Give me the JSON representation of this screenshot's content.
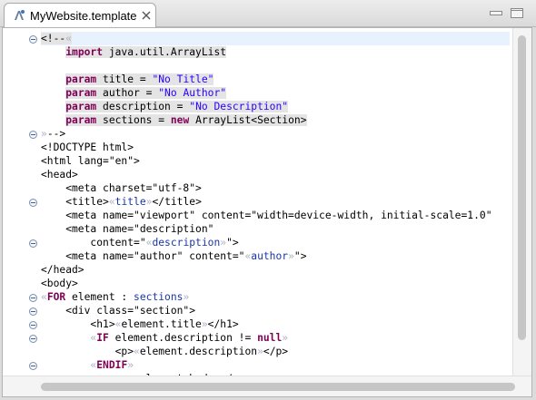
{
  "tab": {
    "title": "MyWebsite.template",
    "icon": "template-file-icon",
    "close_icon": "close-icon"
  },
  "window_controls": {
    "minimize_icon": "minimize-icon",
    "maximize_icon": "maximize-icon"
  },
  "editor": {
    "lines": [
      {
        "segs": [
          {
            "t": "<!--",
            "c": ""
          },
          {
            "t": "«",
            "c": "delim"
          }
        ],
        "cls": "current tpl"
      },
      {
        "segs": [
          {
            "t": "    ",
            "c": ""
          },
          {
            "t": "import",
            "c": "kw"
          },
          {
            "t": " java.util.ArrayList",
            "c": ""
          }
        ],
        "cls": "tpl"
      },
      {
        "segs": [
          {
            "t": " ",
            "c": ""
          }
        ],
        "cls": ""
      },
      {
        "segs": [
          {
            "t": "    ",
            "c": ""
          },
          {
            "t": "param",
            "c": "kw"
          },
          {
            "t": " title = ",
            "c": ""
          },
          {
            "t": "\"No Title\"",
            "c": "str"
          }
        ],
        "cls": "tpl"
      },
      {
        "segs": [
          {
            "t": "    ",
            "c": ""
          },
          {
            "t": "param",
            "c": "kw"
          },
          {
            "t": " author = ",
            "c": ""
          },
          {
            "t": "\"No Author\"",
            "c": "str"
          }
        ],
        "cls": "tpl"
      },
      {
        "segs": [
          {
            "t": "    ",
            "c": ""
          },
          {
            "t": "param",
            "c": "kw"
          },
          {
            "t": " description = ",
            "c": ""
          },
          {
            "t": "\"No Description\"",
            "c": "str"
          }
        ],
        "cls": "tpl"
      },
      {
        "segs": [
          {
            "t": "    ",
            "c": ""
          },
          {
            "t": "param",
            "c": "kw"
          },
          {
            "t": " sections = ",
            "c": ""
          },
          {
            "t": "new",
            "c": "kw"
          },
          {
            "t": " ArrayList<Section>",
            "c": ""
          }
        ],
        "cls": "tpl"
      },
      {
        "segs": [
          {
            "t": "»",
            "c": "delim"
          },
          {
            "t": "-->",
            "c": ""
          }
        ],
        "cls": ""
      },
      {
        "segs": [
          {
            "t": "<!DOCTYPE html>",
            "c": ""
          }
        ],
        "cls": ""
      },
      {
        "segs": [
          {
            "t": "<html lang=\"en\">",
            "c": ""
          }
        ],
        "cls": ""
      },
      {
        "segs": [
          {
            "t": "<head>",
            "c": ""
          }
        ],
        "cls": ""
      },
      {
        "segs": [
          {
            "t": "    <meta charset=\"utf-8\">",
            "c": ""
          }
        ],
        "cls": ""
      },
      {
        "segs": [
          {
            "t": "    <title>",
            "c": ""
          },
          {
            "t": "«",
            "c": "delim"
          },
          {
            "t": "title",
            "c": "expr"
          },
          {
            "t": "»",
            "c": "delim"
          },
          {
            "t": "</title>",
            "c": ""
          }
        ],
        "cls": ""
      },
      {
        "segs": [
          {
            "t": "    <meta name=\"viewport\" content=\"width=device-width, initial-scale=1.0\"",
            "c": ""
          }
        ],
        "cls": ""
      },
      {
        "segs": [
          {
            "t": "    <meta name=\"description\"",
            "c": ""
          }
        ],
        "cls": ""
      },
      {
        "segs": [
          {
            "t": "        content=\"",
            "c": ""
          },
          {
            "t": "«",
            "c": "delim"
          },
          {
            "t": "description",
            "c": "expr"
          },
          {
            "t": "»",
            "c": "delim"
          },
          {
            "t": "\">",
            "c": ""
          }
        ],
        "cls": ""
      },
      {
        "segs": [
          {
            "t": "    <meta name=\"author\" content=\"",
            "c": ""
          },
          {
            "t": "«",
            "c": "delim"
          },
          {
            "t": "author",
            "c": "expr"
          },
          {
            "t": "»",
            "c": "delim"
          },
          {
            "t": "\">",
            "c": ""
          }
        ],
        "cls": ""
      },
      {
        "segs": [
          {
            "t": "</head>",
            "c": ""
          }
        ],
        "cls": ""
      },
      {
        "segs": [
          {
            "t": "<body>",
            "c": ""
          }
        ],
        "cls": ""
      },
      {
        "segs": [
          {
            "t": "«",
            "c": "delim"
          },
          {
            "t": "FOR",
            "c": "kw"
          },
          {
            "t": " element : ",
            "c": ""
          },
          {
            "t": "sections",
            "c": "expr"
          },
          {
            "t": "»",
            "c": "delim"
          }
        ],
        "cls": ""
      },
      {
        "segs": [
          {
            "t": "    <div class=\"section\">",
            "c": ""
          }
        ],
        "cls": ""
      },
      {
        "segs": [
          {
            "t": "        <h1>",
            "c": ""
          },
          {
            "t": "«",
            "c": "delim"
          },
          {
            "t": "element.title",
            "c": ""
          },
          {
            "t": "»",
            "c": "delim"
          },
          {
            "t": "</h1>",
            "c": ""
          }
        ],
        "cls": ""
      },
      {
        "segs": [
          {
            "t": "        ",
            "c": ""
          },
          {
            "t": "«",
            "c": "delim"
          },
          {
            "t": "IF",
            "c": "kw"
          },
          {
            "t": " element.description != ",
            "c": ""
          },
          {
            "t": "null",
            "c": "kw"
          },
          {
            "t": "»",
            "c": "delim"
          }
        ],
        "cls": ""
      },
      {
        "segs": [
          {
            "t": "            <p>",
            "c": ""
          },
          {
            "t": "«",
            "c": "delim"
          },
          {
            "t": "element.description",
            "c": ""
          },
          {
            "t": "»",
            "c": "delim"
          },
          {
            "t": "</p>",
            "c": ""
          }
        ],
        "cls": ""
      },
      {
        "segs": [
          {
            "t": "        ",
            "c": ""
          },
          {
            "t": "«",
            "c": "delim"
          },
          {
            "t": "ENDIF",
            "c": "kw"
          },
          {
            "t": "»",
            "c": "delim"
          }
        ],
        "cls": ""
      },
      {
        "segs": [
          {
            "t": "            <p>",
            "c": ""
          },
          {
            "t": "«",
            "c": "delim"
          },
          {
            "t": "element.body",
            "c": ""
          },
          {
            "t": "»",
            "c": "delim"
          },
          {
            "t": "</p>",
            "c": ""
          }
        ],
        "cls": ""
      }
    ]
  },
  "colors": {
    "keyword": "#7f0055",
    "string": "#2a00ff",
    "expression": "#1a36a8",
    "delimiter": "#a9b3c8",
    "current_line": "#e8f2fe",
    "template_block": "#e4e4e4"
  }
}
